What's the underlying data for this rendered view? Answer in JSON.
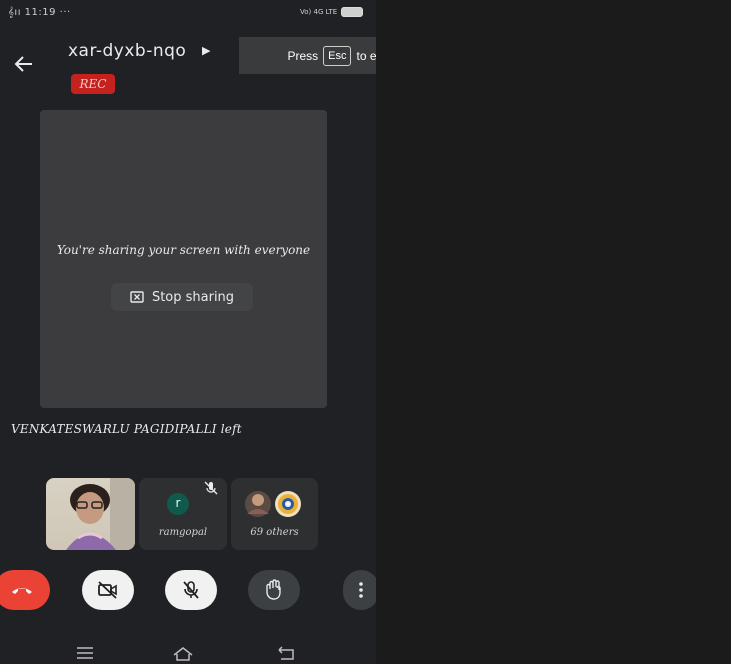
{
  "status_bar": {
    "left_text": "𝄞ıı 11:19 ···",
    "network_text": "Vo) 4G LTE",
    "battery_text": "■"
  },
  "header": {
    "meeting_code": "xar-dyxb-nqo",
    "rec_badge": "REC"
  },
  "fullscreen_banner": {
    "prefix": "Press",
    "key": "Esc",
    "suffix": "to exit full screen"
  },
  "screen_share": {
    "message": "You're sharing your screen with everyone",
    "stop_label": "Stop sharing"
  },
  "notification": "VENKATESWARLU PAGIDIPALLI left",
  "participants": [
    {
      "name": "",
      "type": "self-video"
    },
    {
      "initial": "r",
      "name": "ramgopal",
      "muted": true,
      "avatar_color": "#0f5a4c"
    },
    {
      "name": "69 others",
      "type": "group"
    }
  ],
  "colors": {
    "end_call": "#ea4335",
    "rec": "#c5221f",
    "background": "#202124"
  }
}
